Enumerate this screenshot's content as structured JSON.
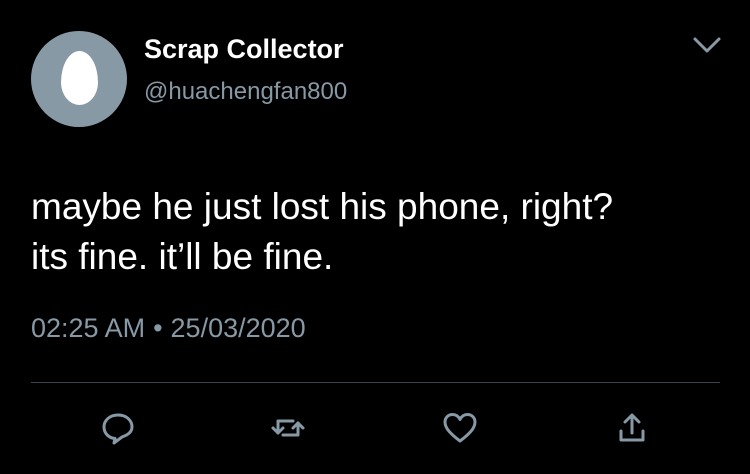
{
  "tweet": {
    "display_name": "Scrap Collector",
    "handle": "@huachengfan800",
    "text_lines": [
      "maybe he just lost his phone, right?",
      "its fine. it’ll be fine."
    ],
    "time": "02:25 AM",
    "separator": "•",
    "date": "25/03/2020"
  },
  "icons": {
    "avatar": "default-egg-avatar",
    "menu": "chevron-down-icon",
    "actions": [
      "reply-icon",
      "retweet-icon",
      "like-icon",
      "share-icon"
    ]
  },
  "colors": {
    "background": "#000000",
    "primary_text": "#ffffff",
    "secondary_text": "#8899a6",
    "divider": "#38444d",
    "avatar_bg": "#8899a6"
  }
}
